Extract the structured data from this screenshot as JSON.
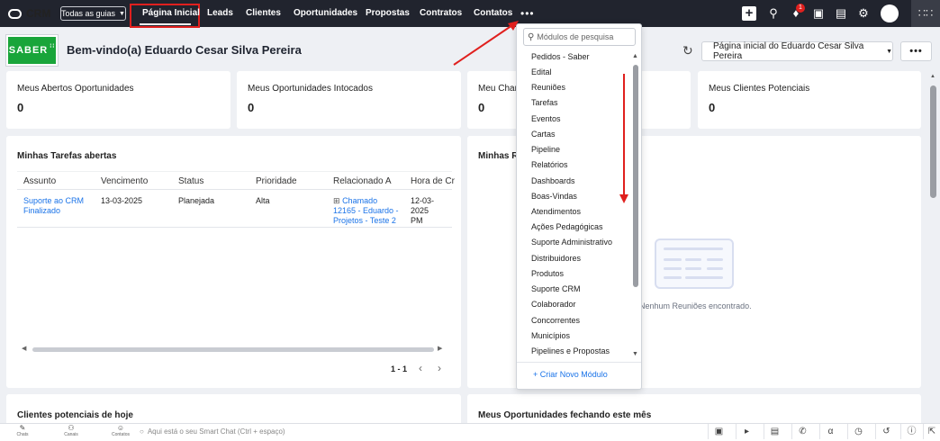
{
  "topnav": {
    "app_name": "CRM",
    "team_select": "Todas as guias",
    "tabs": [
      {
        "label": "Página Inicial"
      },
      {
        "label": "Leads"
      },
      {
        "label": "Clientes"
      },
      {
        "label": "Oportunidades"
      },
      {
        "label": "Propostas"
      },
      {
        "label": "Contratos"
      },
      {
        "label": "Contatos"
      }
    ],
    "more_label": "•••",
    "notification_count": "1",
    "icons": [
      "plus-icon",
      "search-icon",
      "bell-icon",
      "calendar-icon",
      "store-icon",
      "gear-icon",
      "avatar",
      "apps-grid-icon"
    ]
  },
  "header": {
    "logo_text": "SABER",
    "welcome": "Bem-vindo(a) Eduardo Cesar Silva Pereira",
    "homepage_select": "Página inicial do Eduardo Cesar Silva Pereira",
    "more_label": "•••"
  },
  "kpis": [
    {
      "title": "Meus Abertos Oportunidades",
      "value": "0"
    },
    {
      "title": "Meus Oportunidades Intocados",
      "value": "0"
    },
    {
      "title": "Meu Cham",
      "value": "0"
    },
    {
      "title": "Meus Clientes Potenciais",
      "value": "0"
    }
  ],
  "tasks": {
    "title": "Minhas Tarefas abertas",
    "columns": [
      "Assunto",
      "Vencimento",
      "Status",
      "Prioridade",
      "Relacionado A",
      "Hora de Cr"
    ],
    "rows": [
      {
        "subject_line1": "Suporte ao CRM",
        "subject_line2": "Finalizado",
        "due": "13-03-2025",
        "status": "Planejada",
        "priority": "Alta",
        "related_line1": "Chamado",
        "related_line2": "12165 - Eduardo -",
        "related_line3": "Projetos - Teste 2",
        "created_line1": "12-03-2025",
        "created_line2": "PM"
      }
    ],
    "pager": "1 - 1"
  },
  "meetings": {
    "title": "Minhas Re",
    "empty_text": "Nenhum Reuniões encontrado."
  },
  "leads_today": {
    "title": "Clientes potenciais de hoje"
  },
  "opps_closing": {
    "title": "Meus Oportunidades fechando este mês"
  },
  "module_dropdown": {
    "search_placeholder": "Módulos de pesquisa",
    "items": [
      "Pedidos - Saber",
      "Edital",
      "Reuniões",
      "Tarefas",
      "Eventos",
      "Cartas",
      "Pipeline",
      "Relatórios",
      "Dashboards",
      "Boas-Vindas",
      "Atendimentos",
      "Ações Pedagógicas",
      "Suporte Administrativo",
      "Distribuidores",
      "Produtos",
      "Suporte CRM",
      "Colaborador",
      "Concorrentes",
      "Municípios",
      "Pipelines e Propostas"
    ],
    "create_label": "+ Criar Novo Módulo"
  },
  "bottombar": {
    "items": [
      {
        "label": "Chats"
      },
      {
        "label": "Canais"
      },
      {
        "label": "Contatos"
      }
    ],
    "smartchat_placeholder": "Aqui está o seu Smart Chat (Ctrl + espaço)"
  },
  "colors": {
    "nav_bg": "#21242e",
    "highlight": "#e0201e",
    "link": "#1a73e8",
    "brand_green": "#19a53a"
  }
}
